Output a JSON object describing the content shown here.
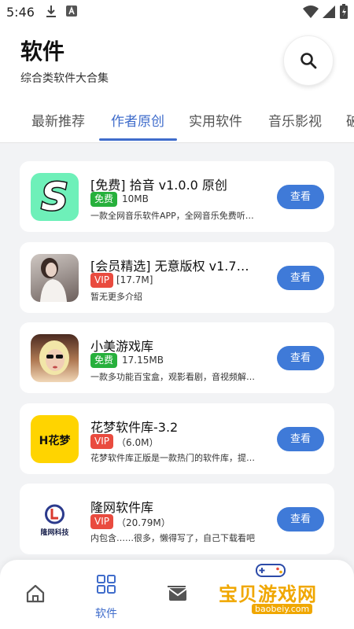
{
  "status_bar": {
    "time": "5:46",
    "icons": [
      "download-icon",
      "font-icon",
      "wifi-icon",
      "signal-icon",
      "battery-icon"
    ]
  },
  "header": {
    "title": "软件",
    "subtitle": "综合类软件大合集",
    "search_icon": "search-icon"
  },
  "tabs": [
    {
      "label": "最新推荐",
      "active": false
    },
    {
      "label": "作者原创",
      "active": true
    },
    {
      "label": "实用软件",
      "active": false
    },
    {
      "label": "音乐影视",
      "active": false
    },
    {
      "label": "破",
      "active": false
    }
  ],
  "apps": [
    {
      "name": "[免费] 拾音 v1.0.0 原创",
      "badge": "免费",
      "badge_type": "free",
      "size": "10MB",
      "description": "一款全网音乐软件APP，全网音乐免费听…",
      "button": "查看",
      "icon": "letter-s-icon"
    },
    {
      "name": "[会员精选] 无意版权 v1.7…",
      "badge": "VIP",
      "badge_type": "vip",
      "size": "[17.7M]",
      "description": "暂无更多介绍",
      "button": "查看",
      "icon": "photo-icon"
    },
    {
      "name": "小美游戏库",
      "badge": "免费",
      "badge_type": "free",
      "size": "17.15MB",
      "description": "一款多功能百宝盒，观影看剧，音视频解…",
      "button": "查看",
      "icon": "photo-icon"
    },
    {
      "name": "花梦软件库-3.2",
      "badge": "VIP",
      "badge_type": "vip",
      "size": "（6.0M）",
      "description": "花梦软件库正版是一款热门的软件库，提…",
      "button": "查看",
      "icon": "huameng-logo-icon",
      "logo_text": "H花梦"
    },
    {
      "name": "隆网软件库",
      "badge": "VIP",
      "badge_type": "vip",
      "size": "（20.79M）",
      "description": "内包含……很多，懒得写了，自己下载看吧",
      "button": "查看",
      "icon": "longwang-logo-icon",
      "logo_text": "隆网科技"
    }
  ],
  "bottom_nav": [
    {
      "label": "",
      "icon": "home-icon",
      "active": false
    },
    {
      "label": "软件",
      "icon": "grid-icon",
      "active": true
    },
    {
      "label": "",
      "icon": "mail-icon",
      "active": false
    }
  ],
  "watermark": {
    "text": "宝贝游戏网",
    "url": "baobeiy.com"
  },
  "colors": {
    "accent": "#3f6ccb",
    "button": "#3f7ad8",
    "free_badge": "#27b03c",
    "vip_badge": "#e94b3f"
  }
}
